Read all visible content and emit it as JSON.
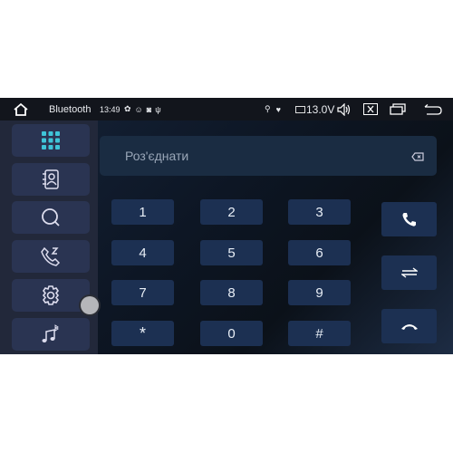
{
  "status": {
    "app_title": "Bluetooth",
    "time": "13:49",
    "voltage": "13.0V"
  },
  "sidebar": {
    "items": [
      {
        "icon": "dialpad-icon",
        "active": true
      },
      {
        "icon": "contacts-icon"
      },
      {
        "icon": "search-icon"
      },
      {
        "icon": "call-history-icon"
      },
      {
        "icon": "settings-icon"
      },
      {
        "icon": "bluetooth-music-icon"
      }
    ]
  },
  "display": {
    "text": "Роз'єднати"
  },
  "keypad": {
    "keys": [
      "1",
      "2",
      "3",
      "4",
      "5",
      "6",
      "7",
      "8",
      "9",
      "*",
      "0",
      "#"
    ]
  },
  "actions": [
    "call-icon",
    "transfer-icon",
    "hangup-icon"
  ],
  "colors": {
    "accent": "#3fc4d8",
    "key_bg": "#1c3052",
    "sidebar_bg": "#22283a"
  }
}
